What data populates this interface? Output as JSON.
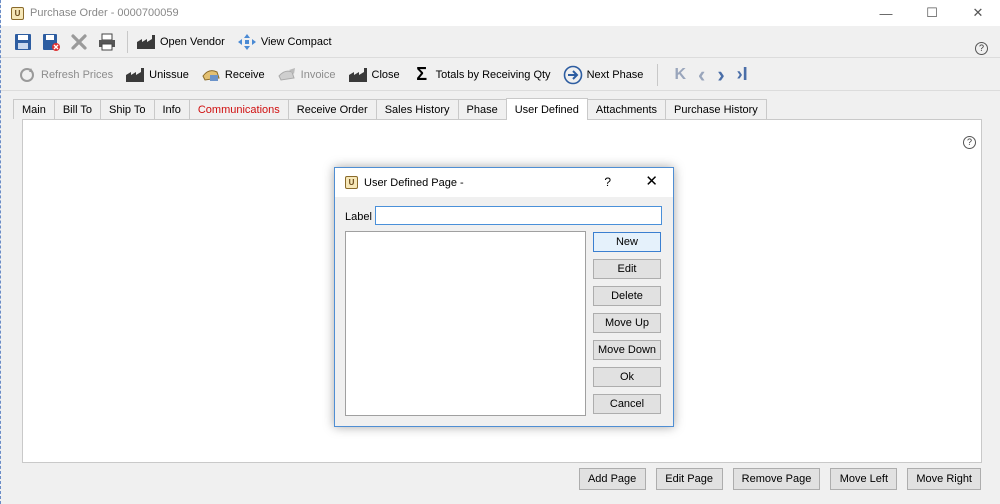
{
  "window": {
    "title": "Purchase Order - 0000700059",
    "app_icon_letter": "U",
    "minimize_glyph": "—",
    "maximize_glyph": "☐",
    "close_glyph": "✕"
  },
  "toolbar1": {
    "open_vendor_label": "Open Vendor",
    "view_compact_label": "View Compact",
    "help_glyph": "?"
  },
  "toolbar2": {
    "refresh_prices_label": "Refresh Prices",
    "unissue_label": "Unissue",
    "receive_label": "Receive",
    "invoice_label": "Invoice",
    "close_label": "Close",
    "totals_label": "Totals by Receiving Qty",
    "next_phase_label": "Next Phase",
    "nav_first": "K",
    "nav_prev": "‹",
    "nav_next": "›",
    "nav_last": "›I"
  },
  "tabs": [
    {
      "label": "Main"
    },
    {
      "label": "Bill To"
    },
    {
      "label": "Ship To"
    },
    {
      "label": "Info"
    },
    {
      "label": "Communications"
    },
    {
      "label": "Receive Order"
    },
    {
      "label": "Sales History"
    },
    {
      "label": "Phase"
    },
    {
      "label": "User Defined"
    },
    {
      "label": "Attachments"
    },
    {
      "label": "Purchase History"
    }
  ],
  "content": {
    "help_glyph": "?"
  },
  "bottom_buttons": {
    "add_page": "Add Page",
    "edit_page": "Edit Page",
    "remove_page": "Remove Page",
    "move_left": "Move Left",
    "move_right": "Move Right"
  },
  "dialog": {
    "title": "User Defined Page -",
    "question_glyph": "?",
    "close_glyph": "✕",
    "label_text": "Label",
    "label_value": "",
    "buttons": {
      "new": "New",
      "edit": "Edit",
      "delete": "Delete",
      "move_up": "Move Up",
      "move_down": "Move Down",
      "ok": "Ok",
      "cancel": "Cancel"
    }
  },
  "colors": {
    "accent_blue": "#4a6ea8",
    "tab_alert_red": "#d01010",
    "dialog_border": "#4f8ed3"
  }
}
